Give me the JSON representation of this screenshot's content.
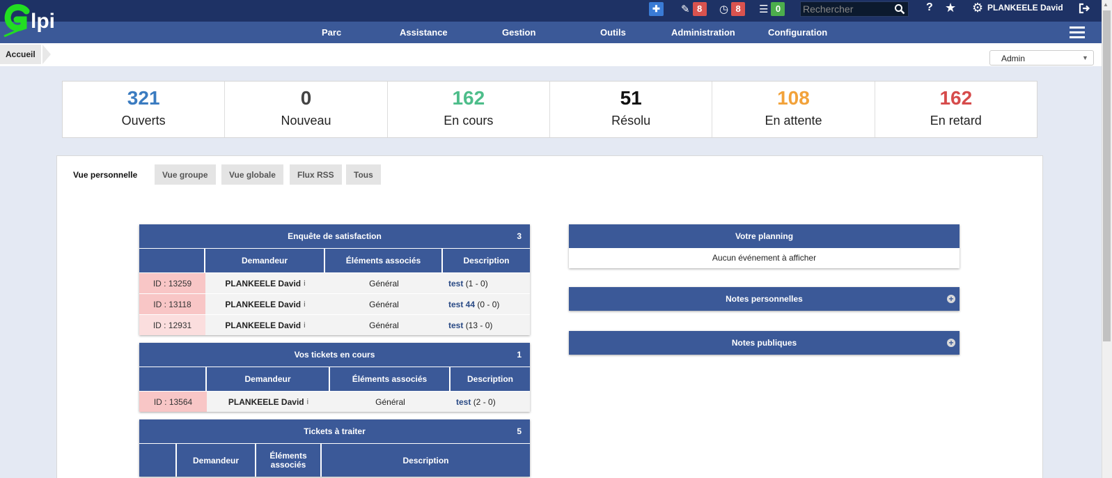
{
  "app": {
    "name": "glpi"
  },
  "topbar": {
    "add_icon": "plus-icon",
    "tickets_badge": "8",
    "planning_badge": "8",
    "list_badge": "0",
    "search_placeholder": "Rechercher",
    "help": "?",
    "user": "PLANKEELE David"
  },
  "menu": [
    "Parc",
    "Assistance",
    "Gestion",
    "Outils",
    "Administration",
    "Configuration"
  ],
  "breadcrumb": "Accueil",
  "profile": "Admin",
  "stats": [
    {
      "value": "321",
      "label": "Ouverts",
      "color": "#3a7bc0"
    },
    {
      "value": "0",
      "label": "Nouveau",
      "color": "#444444"
    },
    {
      "value": "162",
      "label": "En cours",
      "color": "#4dbd8a"
    },
    {
      "value": "51",
      "label": "Résolu",
      "color": "#111111"
    },
    {
      "value": "108",
      "label": "En attente",
      "color": "#f2a23a"
    },
    {
      "value": "162",
      "label": "En retard",
      "color": "#d64b4b"
    }
  ],
  "tabs": [
    "Vue personnelle",
    "Vue groupe",
    "Vue globale",
    "Flux RSS",
    "Tous"
  ],
  "satisfaction": {
    "title": "Enquête de satisfaction",
    "count": "3",
    "columns": [
      "",
      "Demandeur",
      "Éléments associés",
      "Description"
    ],
    "rows": [
      {
        "id": "ID : 13259",
        "req": "PLANKEELE David",
        "el": "Général",
        "link": "test",
        "extra": "(1 - 0)"
      },
      {
        "id": "ID : 13118",
        "req": "PLANKEELE David",
        "el": "Général",
        "link": "test 44",
        "extra": "(0 - 0)"
      },
      {
        "id": "ID : 12931",
        "req": "PLANKEELE David",
        "el": "Général",
        "link": "test",
        "extra": "(13 - 0)"
      }
    ]
  },
  "encours": {
    "title": "Vos tickets en cours",
    "count": "1",
    "columns": [
      "",
      "Demandeur",
      "Éléments associés",
      "Description"
    ],
    "rows": [
      {
        "id": "ID : 13564",
        "req": "PLANKEELE David",
        "el": "Général",
        "link": "test",
        "extra": "(2 - 0)"
      }
    ]
  },
  "atraiter": {
    "title": "Tickets à traiter",
    "count": "5",
    "columns": [
      "",
      "Demandeur",
      "Éléments associés",
      "Description"
    ]
  },
  "planning": {
    "title": "Votre planning",
    "empty": "Aucun événement à afficher"
  },
  "notes_perso": {
    "title": "Notes personnelles"
  },
  "notes_pub": {
    "title": "Notes publiques"
  }
}
